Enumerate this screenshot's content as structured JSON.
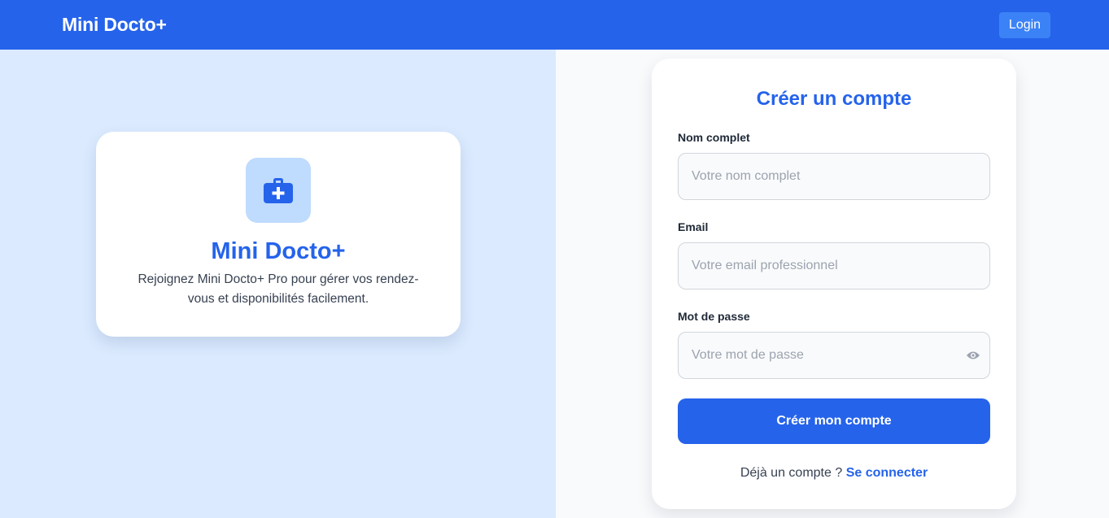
{
  "navbar": {
    "brand": "Mini Docto+",
    "login_label": "Login"
  },
  "intro": {
    "icon": "medical-briefcase-icon",
    "title": "Mini Docto+",
    "text": "Rejoignez Mini Docto+ Pro pour gérer vos rendez-vous et disponibilités facilement."
  },
  "form": {
    "title": "Créer un compte",
    "fields": [
      {
        "label": "Nom complet",
        "value": "",
        "placeholder": "Votre nom complet"
      },
      {
        "label": "Email",
        "value": "",
        "placeholder": "Votre email professionnel"
      },
      {
        "label": "Mot de passe",
        "value": "",
        "placeholder": "Votre mot de passe",
        "toggle_icon": "eye-icon"
      }
    ],
    "submit_label": "Créer mon compte",
    "footer_text": "Déjà un compte ?",
    "footer_link": "Se connecter"
  },
  "colors": {
    "primary": "#2563eb",
    "left_background": "#dbeafe",
    "right_background": "#f8fafc",
    "icon_background": "#bfdbfe"
  }
}
